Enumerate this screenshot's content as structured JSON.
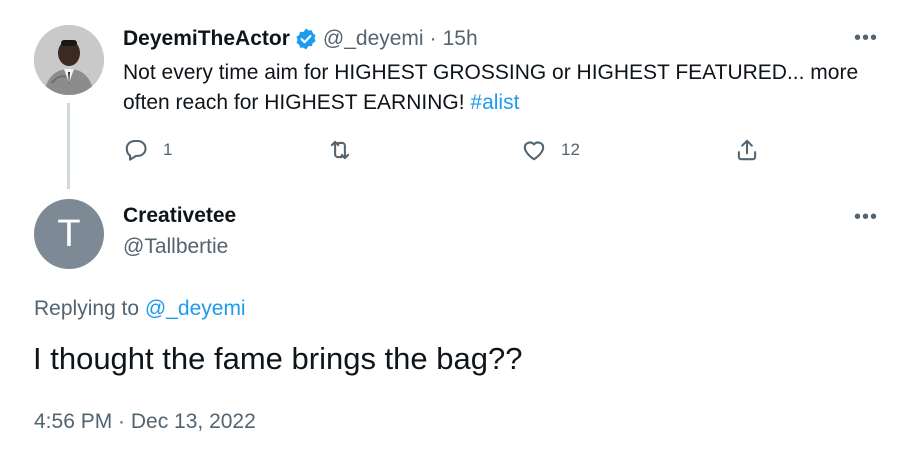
{
  "colors": {
    "text": "#0f1419",
    "secondary": "#536471",
    "link": "#1d9bf0",
    "verified_badge": "#1d9bf0",
    "letter_avatar_bg": "#7d8a95",
    "thread_line": "#cfd9de"
  },
  "original_tweet": {
    "author_name": "DeyemiTheActor",
    "verified": true,
    "handle": "@_deyemi",
    "separator": "·",
    "time_ago": "15h",
    "text": "Not every time aim for HIGHEST GROSSING or HIGHEST FEATURED... more often reach for HIGHEST EARNING!",
    "hashtag": "#alist",
    "more_icon": "more-horizontal-icon",
    "actions": {
      "reply_count": "1",
      "retweet_count": "",
      "like_count": "12",
      "reply_icon": "reply-icon",
      "retweet_icon": "retweet-icon",
      "like_icon": "heart-icon",
      "share_icon": "share-icon"
    }
  },
  "reply_tweet": {
    "avatar_letter": "T",
    "author_name": "Creativetee",
    "handle": "@Tallbertie",
    "replying_to_label": "Replying to",
    "replying_to_handle": "@_deyemi",
    "text": "I thought the fame brings the bag??",
    "timestamp": "4:56 PM · Dec 13, 2022",
    "more_icon": "more-horizontal-icon"
  }
}
